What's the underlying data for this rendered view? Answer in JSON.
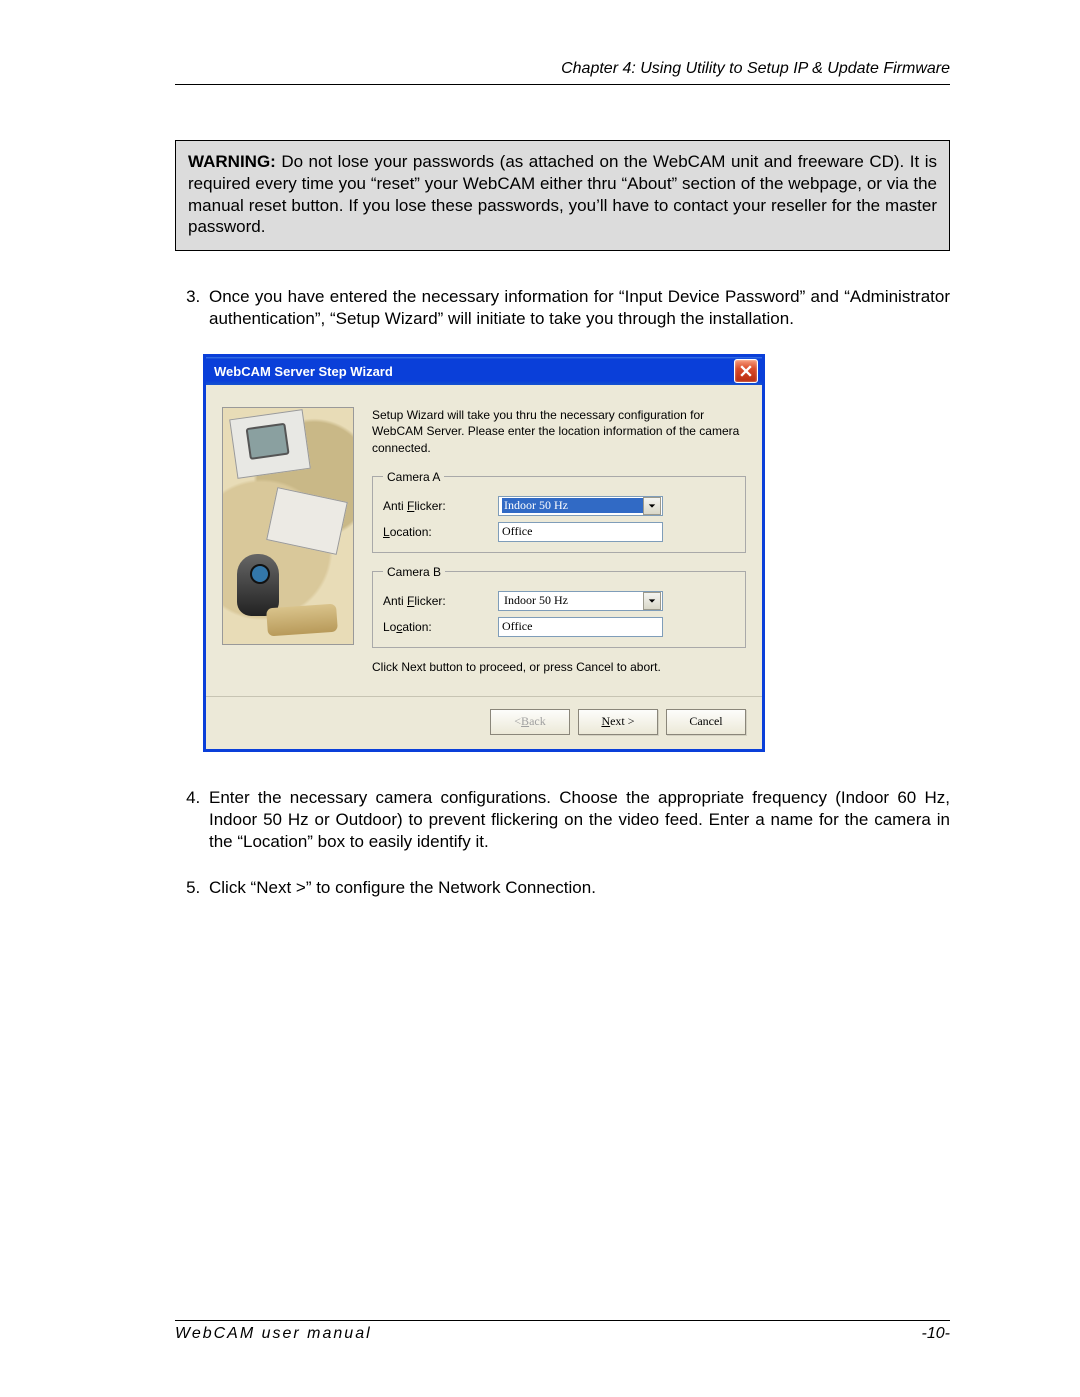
{
  "header": {
    "chapter": "Chapter 4:  Using Utility to Setup IP & Update Firmware"
  },
  "warning": {
    "title": "WARNING:",
    "body": "Do not lose your passwords (as attached on the WebCAM unit and freeware CD). It is required every time you “reset” your WebCAM either thru “About” section of the webpage, or via the manual reset button. If you lose these passwords, you’ll have to contact your reseller for the master password."
  },
  "steps": {
    "s3": "Once you have entered the necessary information for “Input Device Password” and “Administrator authentication”, “Setup Wizard” will initiate to take you through the installation.",
    "s4": "Enter the necessary camera configurations.   Choose the appropriate frequency (Indoor 60 Hz, Indoor 50 Hz or Outdoor) to prevent flickering on the video feed. Enter a name for the camera in the “Location” box to easily identify it.",
    "s5": "Click “Next >” to configure the Network Connection."
  },
  "wizard": {
    "title": "WebCAM Server Step Wizard",
    "intro": "Setup Wizard will take you thru the necessary configuration for WebCAM Server. Please enter the location information of the camera connected.",
    "groupA": "Camera A",
    "groupB": "Camera B",
    "lbl_anti_pre": "Anti ",
    "lbl_anti_u": "F",
    "lbl_anti_post": "licker:",
    "lbl_loc_u": "L",
    "lbl_loc_post_a": "ocation:",
    "lbl_loc_pre_b": "Lo",
    "lbl_loc_u_b": "c",
    "lbl_loc_post_b": "ation:",
    "valA_flicker": "Indoor 50 Hz",
    "valA_location": "Office",
    "valB_flicker": "Indoor 50 Hz",
    "valB_location": "Office",
    "hint": "Click Next button to proceed, or press Cancel to abort.",
    "back_pre": "< ",
    "back_u": "B",
    "back_post": "ack",
    "next_u": "N",
    "next_post": "ext >",
    "cancel": "Cancel"
  },
  "footer": {
    "manual": "WebCAM  user  manual",
    "page": "-10-"
  }
}
